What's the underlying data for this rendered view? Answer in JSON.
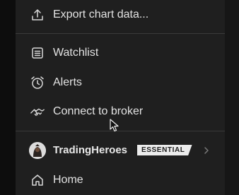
{
  "menu": {
    "export_label": "Export chart data...",
    "watchlist_label": "Watchlist",
    "alerts_label": "Alerts",
    "broker_label": "Connect to broker",
    "profile_name": "TradingHeroes",
    "plan_badge": "ESSENTIAL",
    "home_label": "Home"
  },
  "colors": {
    "menu_background": "#1f1f1f",
    "text": "#e3e3e3",
    "divider": "#3a3a3a",
    "badge_background": "#ececec"
  },
  "icons": [
    "upload-icon",
    "list-icon",
    "alarm-clock-icon",
    "handshake-icon",
    "chevron-right-icon",
    "home-icon"
  ]
}
